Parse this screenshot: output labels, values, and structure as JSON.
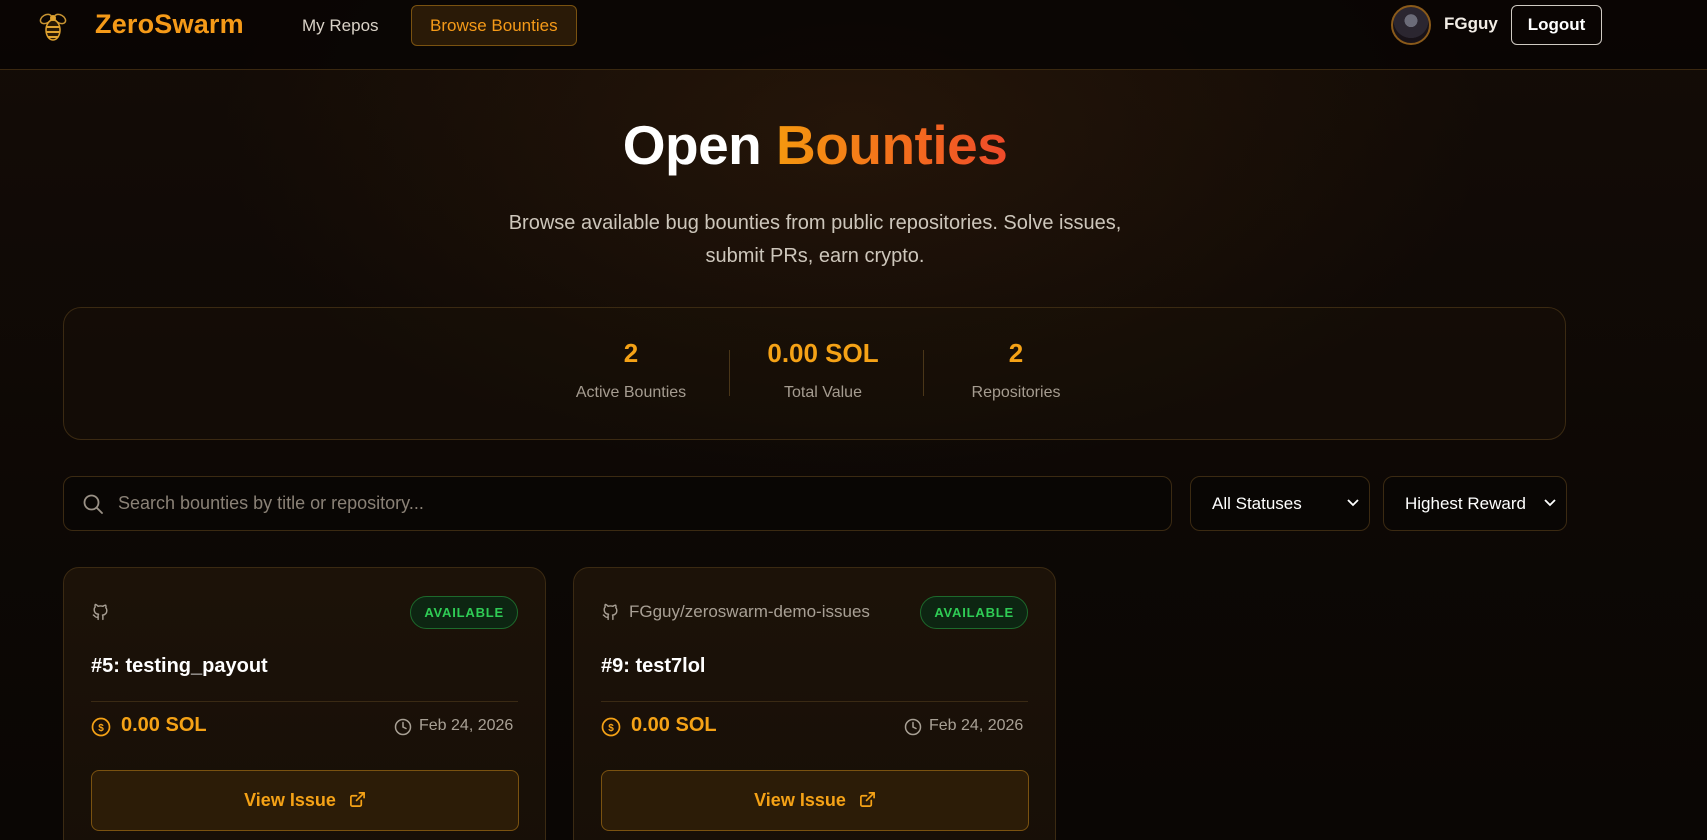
{
  "header": {
    "brand": "ZeroSwarm",
    "nav": [
      {
        "label": "My Repos",
        "active": false
      },
      {
        "label": "Browse Bounties",
        "active": true
      }
    ],
    "user": {
      "name": "FGguy"
    },
    "logout_label": "Logout"
  },
  "hero": {
    "title_part1": "Open",
    "title_part2": "Bounties",
    "subtitle_line1": "Browse available bug bounties from public repositories. Solve issues,",
    "subtitle_line2": "submit PRs, earn crypto."
  },
  "stats": [
    {
      "value": "2",
      "label": "Active Bounties"
    },
    {
      "value": "0.00 SOL",
      "label": "Total Value"
    },
    {
      "value": "2",
      "label": "Repositories"
    }
  ],
  "filters": {
    "search_placeholder": "Search bounties by title or repository...",
    "status_selected": "All Statuses",
    "sort_selected": "Highest Reward"
  },
  "cards": [
    {
      "repo": "",
      "status": "AVAILABLE",
      "title": "#5: testing_payout",
      "reward": "0.00 SOL",
      "date": "Feb 24, 2026",
      "button_label": "View Issue"
    },
    {
      "repo": "FGguy/zeroswarm-demo-issues",
      "status": "AVAILABLE",
      "title": "#9: test7lol",
      "reward": "0.00 SOL",
      "date": "Feb 24, 2026",
      "button_label": "View Issue"
    }
  ],
  "colors": {
    "accent": "#f5a216",
    "brand": "#f59a18",
    "status_available": "#2fcc55",
    "background": "#0b0705"
  },
  "icons": [
    "bee-logo-icon",
    "search-icon",
    "chevron-down-icon",
    "github-icon",
    "coin-icon",
    "clock-icon",
    "external-link-icon"
  ]
}
